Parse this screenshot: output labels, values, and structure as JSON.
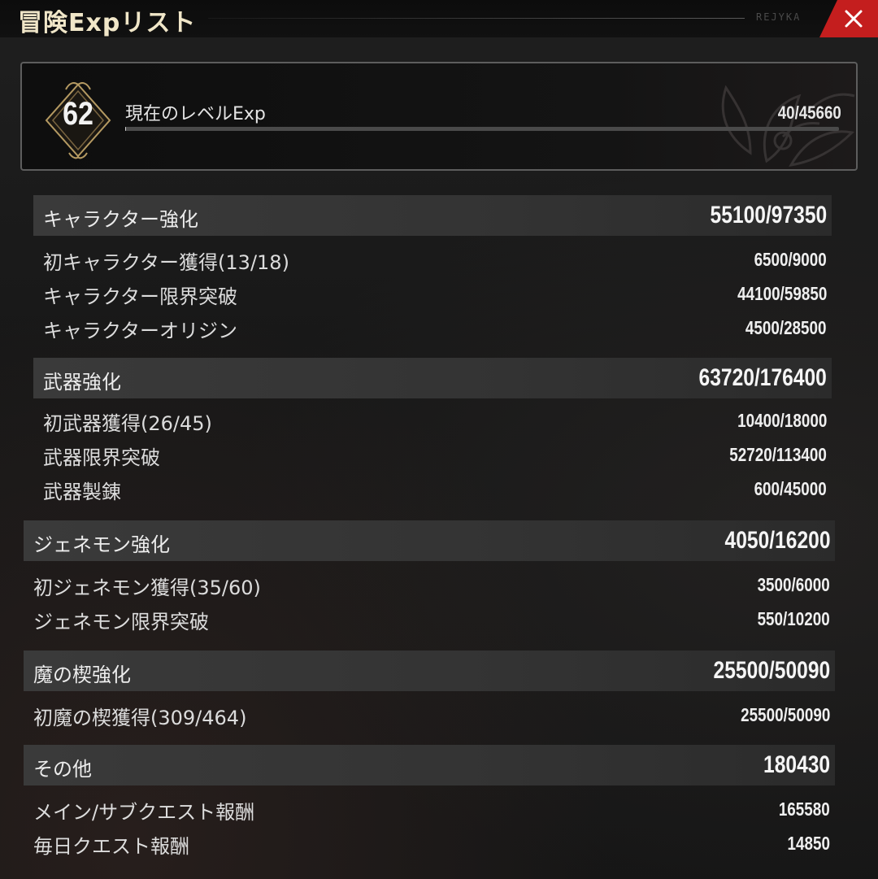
{
  "header": {
    "title": "冒険Expリスト",
    "tag": "REJYKA"
  },
  "level": {
    "number": "62",
    "label": "現在のレベルExp",
    "value": "40/45660",
    "progress_fraction": 0.0009
  },
  "sections": [
    {
      "title": "キャラクター強化",
      "total": "55100/97350",
      "rows": [
        {
          "label": "初キャラクター獲得(13/18)",
          "value": "6500/9000"
        },
        {
          "label": "キャラクター限界突破",
          "value": "44100/59850"
        },
        {
          "label": "キャラクターオリジン",
          "value": "4500/28500"
        }
      ]
    },
    {
      "title": "武器強化",
      "total": "63720/176400",
      "rows": [
        {
          "label": "初武器獲得(26/45)",
          "value": "10400/18000"
        },
        {
          "label": "武器限界突破",
          "value": "52720/113400"
        },
        {
          "label": "武器製錬",
          "value": "600/45000"
        }
      ]
    },
    {
      "title": "ジェネモン強化",
      "total": "4050/16200",
      "rows": [
        {
          "label": "初ジェネモン獲得(35/60)",
          "value": "3500/6000"
        },
        {
          "label": "ジェネモン限界突破",
          "value": "550/10200"
        }
      ]
    },
    {
      "title": "魔の楔強化",
      "total": "25500/50090",
      "rows": [
        {
          "label": "初魔の楔獲得(309/464)",
          "value": "25500/50090"
        }
      ]
    },
    {
      "title": "その他",
      "total": "180430",
      "rows": [
        {
          "label": "メイン/サブクエスト報酬",
          "value": "165580"
        },
        {
          "label": "毎日クエスト報酬",
          "value": "14850"
        }
      ]
    }
  ]
}
